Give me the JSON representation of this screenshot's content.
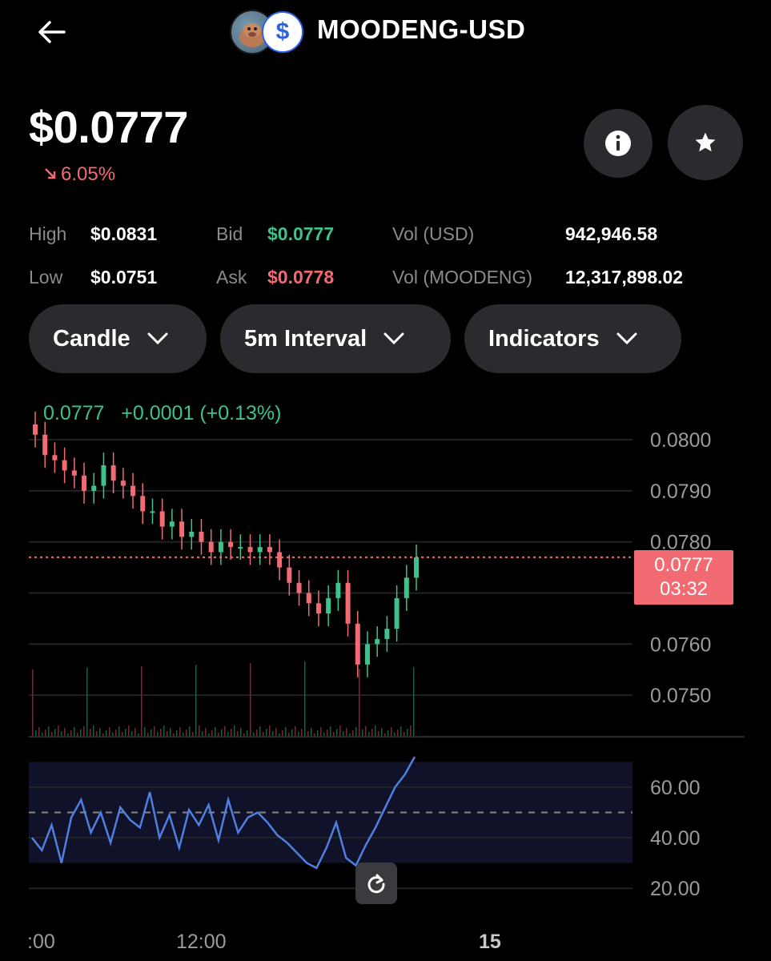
{
  "header": {
    "pair": "MOODENG-USD",
    "icons": [
      "back-arrow-icon",
      "moodeng-coin-icon",
      "usd-coin-icon"
    ]
  },
  "price": {
    "current": "$0.0777",
    "change": "6.05%",
    "change_direction": "down"
  },
  "stats": {
    "high_label": "High",
    "high_value": "$0.0831",
    "low_label": "Low",
    "low_value": "$0.0751",
    "bid_label": "Bid",
    "bid_value": "$0.0777",
    "ask_label": "Ask",
    "ask_value": "$0.0778",
    "vol_usd_label": "Vol (USD)",
    "vol_usd_value": "942,946.58",
    "vol_base_label": "Vol (MOODENG)",
    "vol_base_value": "12,317,898.02"
  },
  "controls": {
    "chart_type": "Candle",
    "interval": "5m Interval",
    "indicators": "Indicators"
  },
  "chart": {
    "last_info": "0.0777   +0.0001 (+0.13%)",
    "current_tag_price": "0.0777",
    "current_tag_timer": "03:32",
    "price_axis": [
      "0.0800",
      "0.0790",
      "0.0780",
      "0.0770",
      "0.0760",
      "0.0750"
    ],
    "rsi_axis": [
      "60.00",
      "40.00",
      "20.00"
    ],
    "time_axis": [
      ":00",
      "12:00",
      "15"
    ]
  },
  "colors": {
    "up": "#3ec28b",
    "down": "#f26b73",
    "rsi_line": "#4f7fe0",
    "panel_bg": "#2a2b2f"
  },
  "chart_data": {
    "type": "line",
    "title": "",
    "series": [
      {
        "values": [
          0.0801,
          0.0797,
          0.0796,
          0.0794,
          0.0793,
          0.079,
          0.0791,
          0.0795,
          0.0792,
          0.0791,
          0.0789,
          0.0786,
          0.0786,
          0.0783,
          0.0784,
          0.0781,
          0.0782,
          0.078,
          0.0778,
          0.078,
          0.0779,
          0.0779,
          0.0778,
          0.0779,
          0.0778,
          0.0775,
          0.0772,
          0.077,
          0.0768,
          0.0766,
          0.0769,
          0.0772,
          0.0764,
          0.0756,
          0.076,
          0.0761,
          0.0763,
          0.0769,
          0.0773,
          0.0777
        ]
      }
    ],
    "rsi": [
      40,
      35,
      45,
      30,
      48,
      55,
      42,
      50,
      38,
      52,
      47,
      44,
      58,
      40,
      49,
      36,
      51,
      45,
      53,
      39,
      55,
      42,
      48,
      50,
      46,
      41,
      38,
      34,
      30,
      28,
      36,
      46,
      32,
      29,
      37,
      44,
      52,
      60,
      65,
      72
    ],
    "ylim": [
      0.0745,
      0.0803
    ],
    "rsi_ylim": [
      15,
      72
    ],
    "grid": true
  }
}
